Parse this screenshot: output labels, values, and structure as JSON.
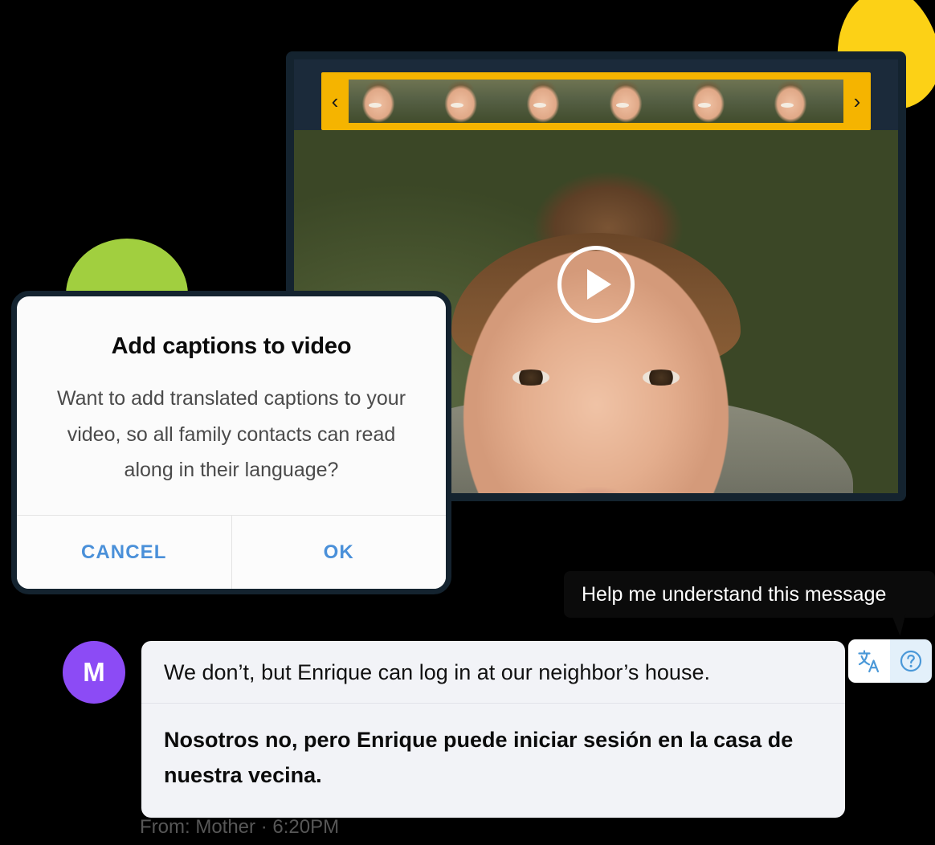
{
  "colors": {
    "accent_yellow": "#FCD116",
    "accent_green": "#A1CF3F",
    "filmstrip_gold": "#F5B400",
    "frame_navy": "#14232F",
    "dialog_link_blue": "#4A90D9",
    "avatar_purple": "#8C4BF5",
    "tooltip_black": "#0B0B0B",
    "bubble_gray": "#F2F3F7",
    "help_btn_blue": "#E3F0FA",
    "icon_blue": "#4A98D8"
  },
  "video_player": {
    "name": "video-preview",
    "play_button_label": "Play",
    "filmstrip": {
      "prev_arrow": "‹",
      "next_arrow": "›",
      "thumbnail_count": 6,
      "thumbnails": [
        "frame-1",
        "frame-2",
        "frame-3",
        "frame-4",
        "frame-5",
        "frame-6"
      ]
    }
  },
  "dialog": {
    "title": "Add captions to video",
    "message": "Want to add translated captions to your video, so all family contacts can read along in their language?",
    "cancel_label": "CANCEL",
    "ok_label": "OK"
  },
  "tooltip": {
    "text": "Help me understand this message"
  },
  "actions": {
    "translate_icon": "translate-icon",
    "translate_glyph_top": "文",
    "translate_glyph_bottom": "A",
    "help_icon": "help-circle-icon",
    "help_glyph": "?"
  },
  "message": {
    "avatar_initial": "M",
    "original_text": "We don’t, but Enrique can log in at our neighbor’s house.",
    "translated_text": "Nosotros no, pero Enrique puede iniciar sesión en la casa de nuestra vecina.",
    "meta": "From: Mother · 6:20PM"
  }
}
